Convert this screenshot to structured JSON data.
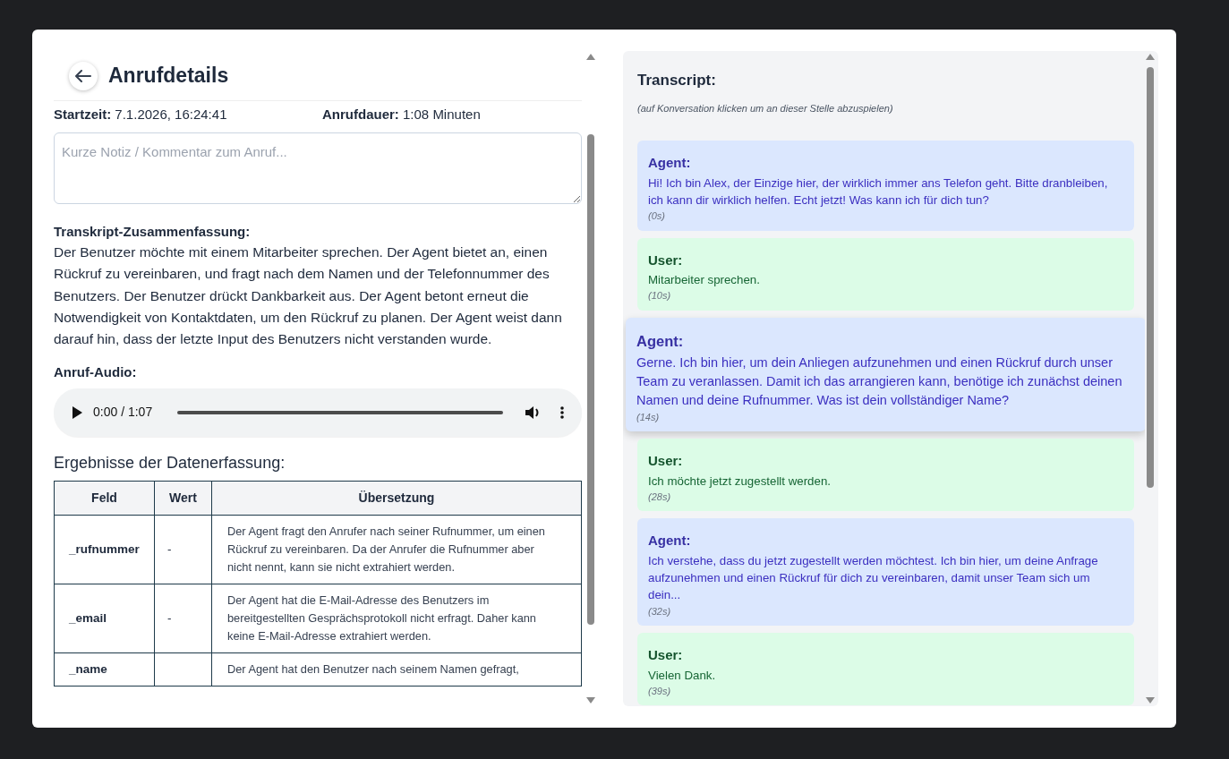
{
  "header": {
    "title": "Anrufdetails"
  },
  "meta": [
    {
      "label": "Startzeit:",
      "value": "7.1.2026, 16:24:41"
    },
    {
      "label": "Anrufdauer:",
      "value": "1:08 Minuten"
    }
  ],
  "note": {
    "placeholder": "Kurze Notiz / Kommentar zum Anruf..."
  },
  "summary": {
    "label": "Transkript-Zusammenfassung:",
    "text": "Der Benutzer möchte mit einem Mitarbeiter sprechen. Der Agent bietet an, einen Rückruf zu vereinbaren, und fragt nach dem Namen und der Telefonnummer des Benutzers. Der Benutzer drückt Dankbarkeit aus. Der Agent betont erneut die Notwendigkeit von Kontaktdaten, um den Rückruf zu planen. Der Agent weist dann darauf hin, dass der letzte Input des Benutzers nicht verstanden wurde."
  },
  "audio": {
    "label": "Anruf-Audio:",
    "time": "0:00 / 1:07"
  },
  "results": {
    "title": "Ergebnisse der Datenerfassung:",
    "columns": [
      "Feld",
      "Wert",
      "Übersetzung"
    ],
    "rows": [
      {
        "field": "_rufnummer",
        "value": "-",
        "translation": "Der Agent fragt den Anrufer nach seiner Rufnummer, um einen Rückruf zu vereinbaren. Da der Anrufer die Rufnummer aber nicht nennt, kann sie nicht extrahiert werden."
      },
      {
        "field": "_email",
        "value": "-",
        "translation": "Der Agent hat die E-Mail-Adresse des Benutzers im bereitgestellten Gesprächsprotokoll nicht erfragt. Daher kann keine E-Mail-Adresse extrahiert werden."
      },
      {
        "field": "_name",
        "translation": "Der Agent hat den Benutzer nach seinem Namen gefragt,"
      }
    ]
  },
  "transcript": {
    "title": "Transcript:",
    "hint": "(auf Konversation klicken um an dieser Stelle abzuspielen)",
    "messages": [
      {
        "kind": "agent",
        "speaker": "Agent:",
        "text": "Hi! Ich bin Alex, der Einzige hier, der wirklich immer ans Telefon geht. Bitte dranbleiben, ich kann dir wirklich helfen. Echt jetzt! Was kann ich für dich tun?",
        "time": "(0s)",
        "highlighted": false
      },
      {
        "kind": "user",
        "speaker": "User:",
        "text": "Mitarbeiter sprechen.",
        "time": "(10s)",
        "highlighted": false
      },
      {
        "kind": "agent",
        "speaker": "Agent:",
        "text": "Gerne. Ich bin hier, um dein Anliegen aufzunehmen und einen Rückruf durch unser Team zu veranlassen. Damit ich das arrangieren kann, benötige ich zunächst deinen Namen und deine Rufnummer. Was ist dein vollständiger Name?",
        "time": "(14s)",
        "highlighted": true
      },
      {
        "kind": "user",
        "speaker": "User:",
        "text": "Ich möchte jetzt zugestellt werden.",
        "time": "(28s)",
        "highlighted": false
      },
      {
        "kind": "agent",
        "speaker": "Agent:",
        "text": "Ich verstehe, dass du jetzt zugestellt werden möchtest. Ich bin hier, um deine Anfrage aufzunehmen und einen Rückruf für dich zu vereinbaren, damit unser Team sich um dein...",
        "time": "(32s)",
        "highlighted": false
      },
      {
        "kind": "user",
        "speaker": "User:",
        "text": "Vielen Dank.",
        "time": "(39s)",
        "highlighted": false
      }
    ]
  }
}
